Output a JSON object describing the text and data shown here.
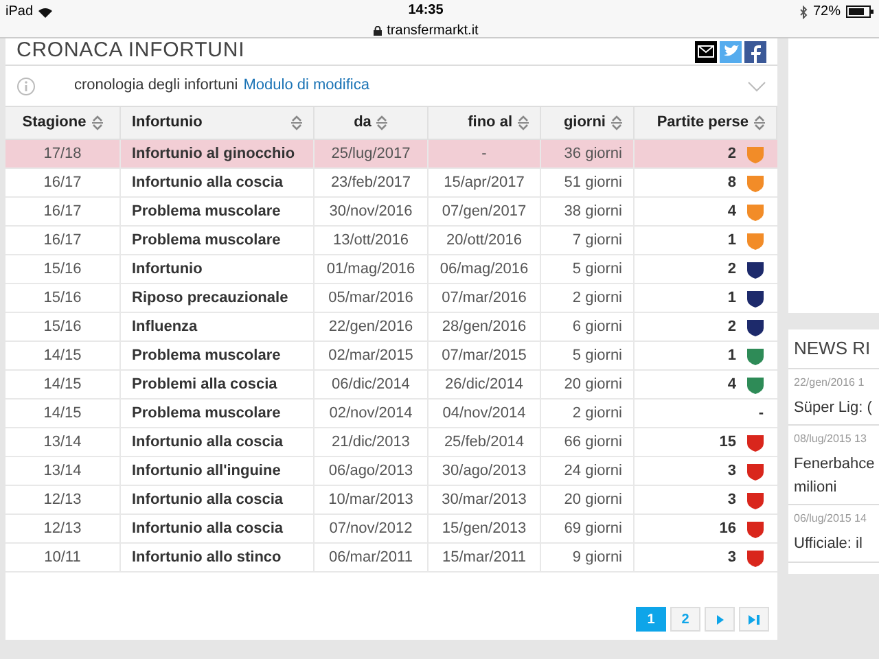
{
  "status_bar": {
    "device": "iPad",
    "time": "14:35",
    "url": "transfermarkt.it",
    "battery": "72%"
  },
  "section": {
    "title": "CRONACA INFORTUNI",
    "subtitle": "cronologia degli infortuni",
    "link": "Modulo di modifica"
  },
  "table": {
    "columns": [
      "Stagione",
      "Infortunio",
      "da",
      "fino al",
      "giorni",
      "Partite perse"
    ],
    "rows": [
      {
        "season": "17/18",
        "injury": "Infortunio al ginocchio",
        "from": "25/lug/2017",
        "until": "-",
        "days": "36 giorni",
        "missed": "2",
        "color": "#f28c28",
        "highlighted": true
      },
      {
        "season": "16/17",
        "injury": "Infortunio alla coscia",
        "from": "23/feb/2017",
        "until": "15/apr/2017",
        "days": "51 giorni",
        "missed": "8",
        "color": "#f28c28",
        "highlighted": false
      },
      {
        "season": "16/17",
        "injury": "Problema muscolare",
        "from": "30/nov/2016",
        "until": "07/gen/2017",
        "days": "38 giorni",
        "missed": "4",
        "color": "#f28c28",
        "highlighted": false
      },
      {
        "season": "16/17",
        "injury": "Problema muscolare",
        "from": "13/ott/2016",
        "until": "20/ott/2016",
        "days": "7 giorni",
        "missed": "1",
        "color": "#f28c28",
        "highlighted": false
      },
      {
        "season": "15/16",
        "injury": "Infortunio",
        "from": "01/mag/2016",
        "until": "06/mag/2016",
        "days": "5 giorni",
        "missed": "2",
        "color": "#1d2a6b",
        "highlighted": false
      },
      {
        "season": "15/16",
        "injury": "Riposo precauzionale",
        "from": "05/mar/2016",
        "until": "07/mar/2016",
        "days": "2 giorni",
        "missed": "1",
        "color": "#1d2a6b",
        "highlighted": false
      },
      {
        "season": "15/16",
        "injury": "Influenza",
        "from": "22/gen/2016",
        "until": "28/gen/2016",
        "days": "6 giorni",
        "missed": "2",
        "color": "#1d2a6b",
        "highlighted": false
      },
      {
        "season": "14/15",
        "injury": "Problema muscolare",
        "from": "02/mar/2015",
        "until": "07/mar/2015",
        "days": "5 giorni",
        "missed": "1",
        "color": "#2e8b57",
        "highlighted": false
      },
      {
        "season": "14/15",
        "injury": "Problemi alla coscia",
        "from": "06/dic/2014",
        "until": "26/dic/2014",
        "days": "20 giorni",
        "missed": "4",
        "color": "#2e8b57",
        "highlighted": false
      },
      {
        "season": "14/15",
        "injury": "Problema muscolare",
        "from": "02/nov/2014",
        "until": "04/nov/2014",
        "days": "2 giorni",
        "missed": "-",
        "highlighted": false
      },
      {
        "season": "13/14",
        "injury": "Infortunio alla coscia",
        "from": "21/dic/2013",
        "until": "25/feb/2014",
        "days": "66 giorni",
        "missed": "15",
        "color": "#d9261c",
        "highlighted": false
      },
      {
        "season": "13/14",
        "injury": "Infortunio all'inguine",
        "from": "06/ago/2013",
        "until": "30/ago/2013",
        "days": "24 giorni",
        "missed": "3",
        "color": "#d9261c",
        "highlighted": false
      },
      {
        "season": "12/13",
        "injury": "Infortunio alla coscia",
        "from": "10/mar/2013",
        "until": "30/mar/2013",
        "days": "20 giorni",
        "missed": "3",
        "color": "#d9261c",
        "highlighted": false
      },
      {
        "season": "12/13",
        "injury": "Infortunio alla coscia",
        "from": "07/nov/2012",
        "until": "15/gen/2013",
        "days": "69 giorni",
        "missed": "16",
        "color": "#d9261c",
        "highlighted": false
      },
      {
        "season": "10/11",
        "injury": "Infortunio allo stinco",
        "from": "06/mar/2011",
        "until": "15/mar/2011",
        "days": "9 giorni",
        "missed": "3",
        "color": "#d9261c",
        "highlighted": false
      }
    ]
  },
  "pagination": [
    {
      "label": "1",
      "selected": true
    },
    {
      "label": "2",
      "selected": false
    }
  ],
  "news": {
    "title": "NEWS RI",
    "items": [
      {
        "date": "22/gen/2016 1",
        "headline": "Süper Lig: ("
      },
      {
        "date": "08/lug/2015 13",
        "headline": "Fenerbahce milioni"
      },
      {
        "date": "06/lug/2015 14",
        "headline": "Ufficiale: il"
      }
    ]
  }
}
